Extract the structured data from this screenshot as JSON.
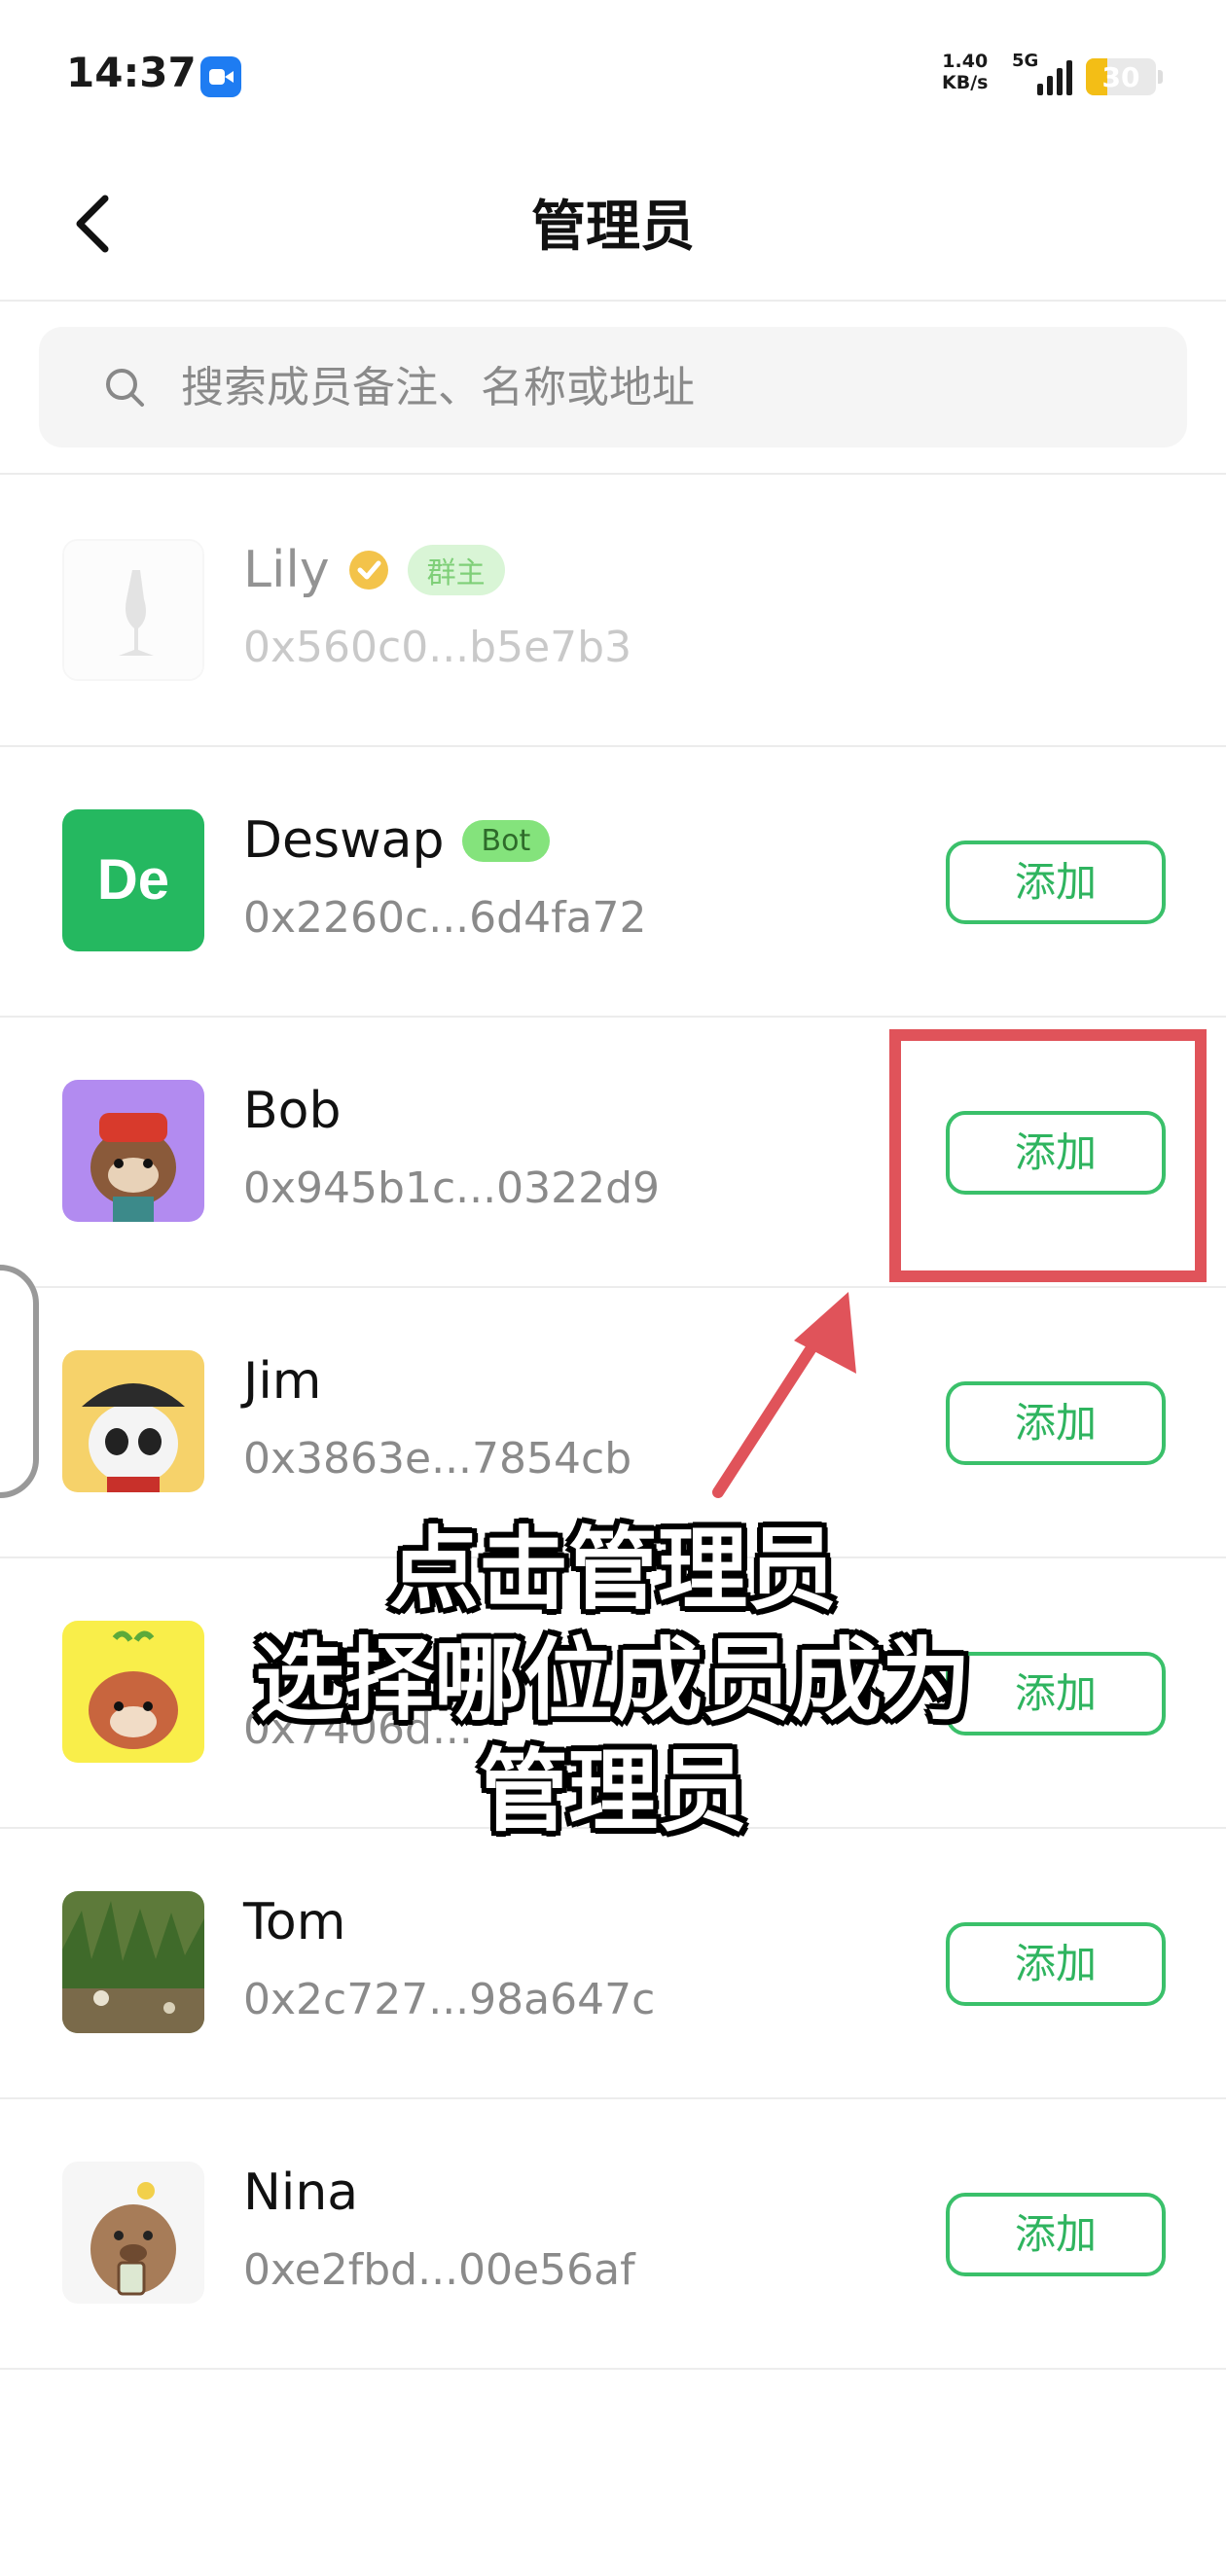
{
  "status": {
    "time": "14:37",
    "speed_line1": "1.40",
    "speed_line2": "KB/s",
    "network": "5G",
    "battery": "30",
    "battery_level": 0.3,
    "battery_color": "#f3be16"
  },
  "header": {
    "back_icon": "chevron-left-icon",
    "title": "管理员"
  },
  "search": {
    "placeholder": "搜索成员备注、名称或地址",
    "value": ""
  },
  "members": [
    {
      "name": "Lily",
      "address": "0x560c0...b5e7b3",
      "badge": "群主",
      "verified": true,
      "add_label": ""
    },
    {
      "name": "Deswap",
      "address": "0x2260c...6d4fa72",
      "badge": "Bot",
      "avatar_text": "De",
      "add_label": "添加"
    },
    {
      "name": "Bob",
      "address": "0x945b1c...0322d9",
      "add_label": "添加"
    },
    {
      "name": "Jim",
      "address": "0x3863e...7854cb",
      "add_label": "添加"
    },
    {
      "name": "",
      "address": "0x7406d...",
      "add_label": "添加"
    },
    {
      "name": "Tom",
      "address": "0x2c727...98a647c",
      "add_label": "添加"
    },
    {
      "name": "Nina",
      "address": "0xe2fbd...00e56af",
      "add_label": "添加"
    }
  ],
  "overlay": {
    "line1": "点击管理员",
    "line2": "选择哪位成员成为",
    "line3": "管理员"
  },
  "colors": {
    "accent_green": "#3ac06a",
    "highlight_red": "#e0535a"
  }
}
